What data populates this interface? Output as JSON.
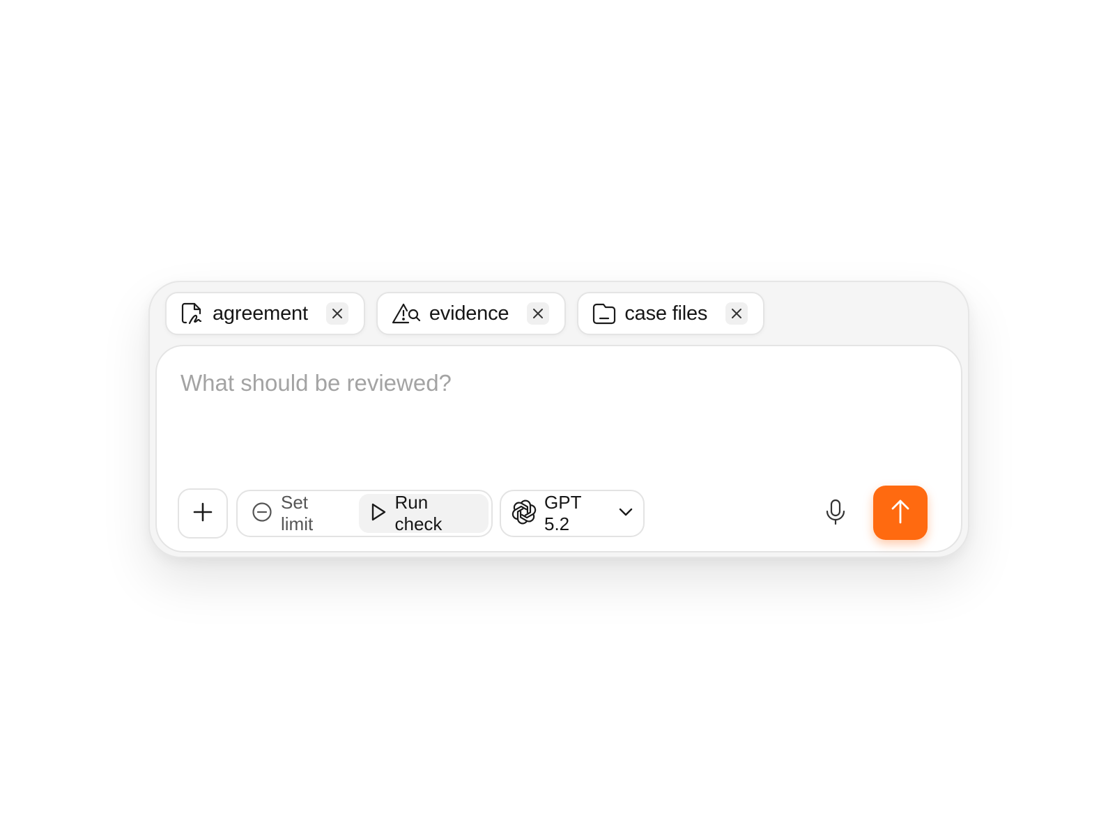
{
  "chips": [
    {
      "label": "agreement",
      "icon": "signed-document-icon"
    },
    {
      "label": "evidence",
      "icon": "warning-search-icon"
    },
    {
      "label": "case files",
      "icon": "folder-icon"
    }
  ],
  "input": {
    "placeholder": "What should be reviewed?",
    "value": ""
  },
  "toolbar": {
    "add_icon": "plus-icon",
    "set_limit_label": "Set limit",
    "set_limit_icon": "minus-circle-icon",
    "run_check_label": "Run check",
    "run_check_icon": "play-icon",
    "model": {
      "label": "GPT 5.2",
      "icon": "openai-logo-icon",
      "dropdown_icon": "chevron-down-icon"
    },
    "mic_icon": "microphone-icon",
    "send_icon": "arrow-up-icon"
  },
  "colors": {
    "accent": "#FF6A10",
    "placeholder": "#A3A3A3",
    "text": "#161616",
    "composer_bg": "#F5F5F5"
  }
}
